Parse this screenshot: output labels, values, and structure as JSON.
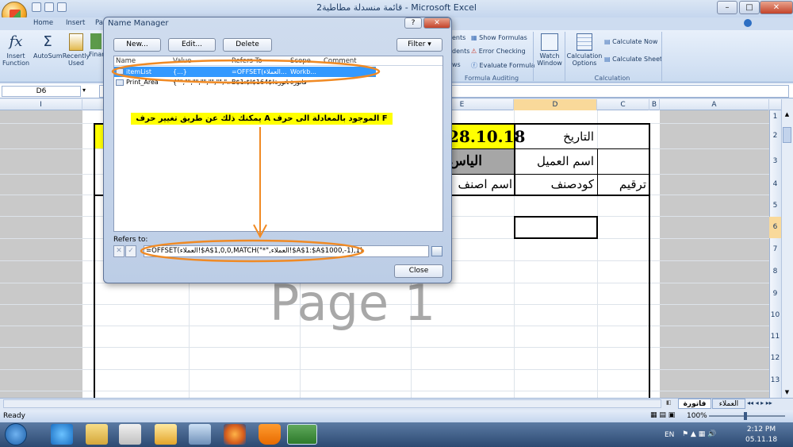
{
  "window": {
    "title": "قائمة منسدلة مطاطية2 - Microsoft Excel"
  },
  "ribbon": {
    "tabs": [
      "Home",
      "Insert",
      "Pa"
    ],
    "buttons": {
      "insert_function": "Insert\nFunction",
      "autosum": "AutoSum",
      "recently_used": "Recently\nUsed",
      "financial": "Finan",
      "dependents_partial": "ents",
      "dependents2_partial": "dents",
      "show_formulas": "Show Formulas",
      "error_checking": "Error Checking",
      "evaluate_formula": "Evaluate Formula",
      "watch_window": "Watch\nWindow",
      "calc_options": "Calculation\nOptions",
      "calc_now": "Calculate Now",
      "calc_sheet": "Calculate Sheet",
      "ws_partial": "ws"
    },
    "groups": {
      "formula_auditing": "Formula Auditing",
      "calculation": "Calculation"
    }
  },
  "formula_bar": {
    "namebox": "D6"
  },
  "columns": [
    "A",
    "B",
    "C",
    "D",
    "E",
    "I"
  ],
  "rows": [
    "1",
    "2",
    "3",
    "4",
    "5",
    "6",
    "7",
    "8",
    "9",
    "10",
    "11",
    "12",
    "13"
  ],
  "sheet": {
    "date_label": "التاريخ",
    "date_value": "28.10.18",
    "customer_label": "اسم العميل",
    "customer_value_partial": "الياس",
    "header_serial": "ترقيم",
    "header_code": "كودصنف",
    "header_item_partial": "اسم اصنف",
    "watermark": "Page 1"
  },
  "dialog": {
    "title": "Name Manager",
    "help": "?",
    "close_x": "✕",
    "new_btn": "New...",
    "edit_btn": "Edit...",
    "delete_btn": "Delete",
    "filter_btn": "Filter ▾",
    "col_name": "Name",
    "col_value": "Value",
    "col_refers": "Refers To",
    "col_scope": "Scope",
    "col_comment": "Comment",
    "rows": [
      {
        "name": "itemList",
        "value": "{...}",
        "refers": "=OFFSET(العملاء...",
        "scope": "Workb..."
      },
      {
        "name": "Print_Area",
        "value": "{\"\",\"\",\"\",\"\",\"\",\"\",\"...",
        "refers": "B$1:$I$164$!فاتورة",
        "scope": "فاتورة"
      }
    ],
    "refers_label": "Refers to:",
    "refers_value": "=OFFSET(العملاء!$A$1,0,0,MATCH(\"*\",العملاء!$A$1:$A$1000,-1),1)",
    "close_btn": "Close"
  },
  "annotation": {
    "note": "يمكنك ذلك عن طريق تغيير حرف A الموجود بالمعادلة الى حرف F"
  },
  "sheet_tabs": [
    "فاتورة",
    "العملاء"
  ],
  "status": {
    "ready": "Ready",
    "zoom": "100%"
  },
  "taskbar": {
    "lang": "EN",
    "time": "2:12 PM",
    "date": "05.11.18"
  },
  "colors": {
    "annotation_orange": "#f08a24",
    "selection_blue": "#3399ff",
    "highlight_yellow": "#ffff00"
  }
}
